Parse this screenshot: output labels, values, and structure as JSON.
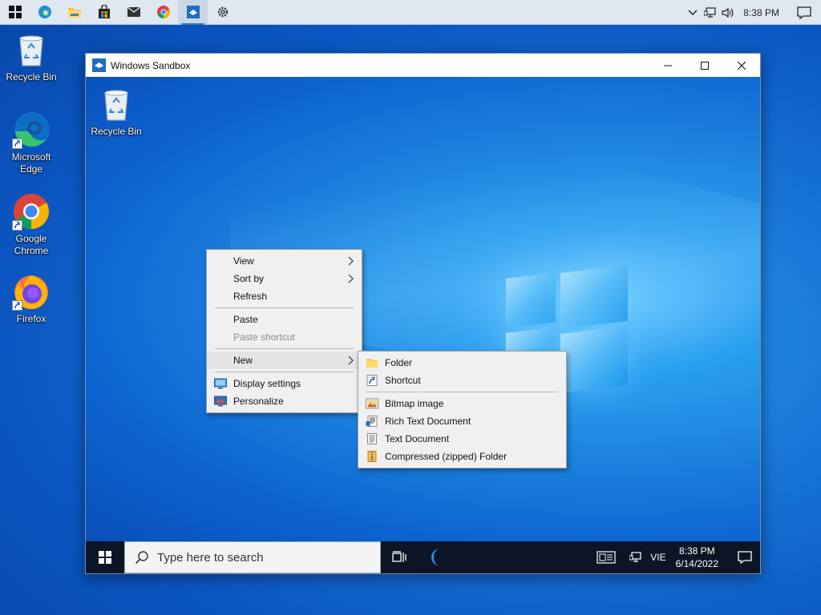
{
  "host_taskbar": {
    "apps": [
      "windows-start",
      "edge",
      "file-explorer",
      "microsoft-store",
      "mail",
      "chrome",
      "windows-sandbox",
      "settings"
    ],
    "clock": "8:38 PM"
  },
  "host_desktop": {
    "icons": [
      {
        "label": "Recycle Bin",
        "icon": "recycle-bin-icon"
      },
      {
        "label": "Microsoft Edge",
        "icon": "edge-icon"
      },
      {
        "label": "Google Chrome",
        "icon": "chrome-icon"
      },
      {
        "label": "Firefox",
        "icon": "firefox-icon"
      }
    ]
  },
  "sandbox": {
    "title": "Windows Sandbox",
    "desktop_icon_label": "Recycle Bin",
    "search_placeholder": "Type here to search",
    "language": "VIE",
    "time": "8:38 PM",
    "date": "6/14/2022"
  },
  "context_menu": {
    "items": [
      {
        "label": "View",
        "submenu": true
      },
      {
        "label": "Sort by",
        "submenu": true
      },
      {
        "label": "Refresh"
      },
      {
        "label": "Paste"
      },
      {
        "label": "Paste shortcut",
        "disabled": true
      },
      {
        "label": "New",
        "submenu": true,
        "highlighted": true
      },
      {
        "label": "Display settings",
        "icon": "display-settings-icon"
      },
      {
        "label": "Personalize",
        "icon": "personalize-icon"
      }
    ]
  },
  "new_submenu": {
    "items": [
      {
        "label": "Folder",
        "icon": "folder-icon"
      },
      {
        "label": "Shortcut",
        "icon": "shortcut-icon"
      },
      {
        "label": "Bitmap image",
        "icon": "bitmap-icon"
      },
      {
        "label": "Rich Text Document",
        "icon": "rtf-icon"
      },
      {
        "label": "Text Document",
        "icon": "text-document-icon"
      },
      {
        "label": "Compressed (zipped) Folder",
        "icon": "zip-folder-icon"
      }
    ]
  },
  "colors": {
    "accent": "#3b78c4",
    "menu_bg": "#f0f0f0",
    "sandbox_taskbar": "#0b1526"
  }
}
